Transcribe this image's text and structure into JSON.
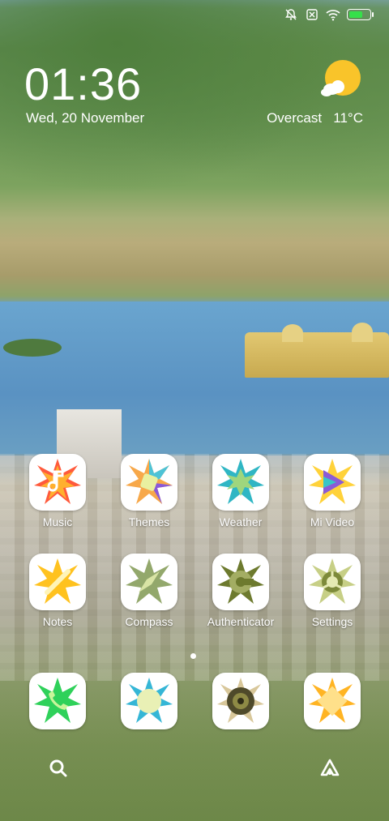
{
  "status_bar": {
    "icons": [
      "alarm-off-icon",
      "sim-off-icon",
      "wifi-icon",
      "battery-charging-icon"
    ],
    "battery_color": "#35e04a"
  },
  "clock": {
    "time": "01:36",
    "date": "Wed, 20 November"
  },
  "weather": {
    "condition": "Overcast",
    "temperature": "11°C",
    "icon": "sun-cloud-icon"
  },
  "apps": [
    {
      "label": "Music",
      "icon": "music-icon"
    },
    {
      "label": "Themes",
      "icon": "themes-icon"
    },
    {
      "label": "Weather",
      "icon": "weather-icon"
    },
    {
      "label": "Mi Video",
      "icon": "mi-video-icon"
    },
    {
      "label": "Notes",
      "icon": "notes-icon"
    },
    {
      "label": "Compass",
      "icon": "compass-icon"
    },
    {
      "label": "Authenticator",
      "icon": "authenticator-icon"
    },
    {
      "label": "Settings",
      "icon": "settings-icon"
    }
  ],
  "dock": [
    {
      "icon": "phone-icon"
    },
    {
      "icon": "messages-icon"
    },
    {
      "icon": "camera-icon"
    },
    {
      "icon": "gallery-icon"
    }
  ],
  "bottom_bar": {
    "left_icon": "search-icon",
    "right_icon": "launcher-icon"
  }
}
